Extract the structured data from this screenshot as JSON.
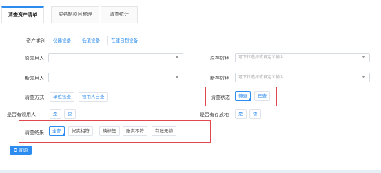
{
  "tabs": [
    {
      "label": "清查资产清单"
    },
    {
      "label": "实名制项目整理"
    },
    {
      "label": "清查统计"
    }
  ],
  "asset_type": {
    "label": "资产类别",
    "options": [
      "仪器设备",
      "低值设备",
      "在建自制设备"
    ]
  },
  "orig_user": {
    "label": "原领用人",
    "placeholder": ""
  },
  "new_user": {
    "label": "新领用人",
    "placeholder": ""
  },
  "orig_location": {
    "label": "原存放地",
    "placeholder": "可下拉选择或自定义输入"
  },
  "new_location": {
    "label": "新存放地",
    "placeholder": "可下拉选择或自定义输入"
  },
  "check_method": {
    "label": "清查方式",
    "options": [
      "单位核查",
      "领用人自查"
    ]
  },
  "check_status": {
    "label": "清查状态",
    "options": [
      "待查",
      "已查"
    ],
    "selected": "待查"
  },
  "has_user": {
    "label": "是否有领用人",
    "options": [
      "是",
      "否"
    ]
  },
  "has_location": {
    "label": "是否有存放地",
    "options": [
      "是",
      "否"
    ]
  },
  "check_result": {
    "label": "清查结果",
    "options": [
      "全部",
      "帐实相符",
      "缺标签",
      "账实不符",
      "有账无物"
    ],
    "selected": "全部"
  },
  "query_button": {
    "label": "查询"
  },
  "colors": {
    "accent": "#2d8cf0",
    "highlight_border": "#e0484f"
  }
}
